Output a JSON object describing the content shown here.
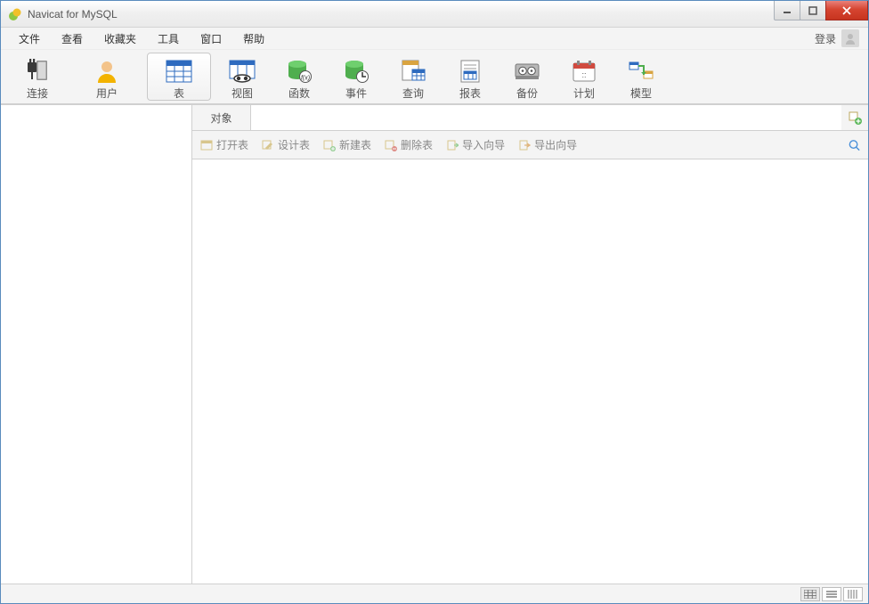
{
  "window": {
    "title": "Navicat for MySQL"
  },
  "menu": {
    "file": "文件",
    "view": "查看",
    "favorites": "收藏夹",
    "tools": "工具",
    "window": "窗口",
    "help": "帮助",
    "login": "登录"
  },
  "toolbar": {
    "connection": "连接",
    "user": "用户",
    "table": "表",
    "view": "视图",
    "function": "函数",
    "event": "事件",
    "query": "查询",
    "report": "报表",
    "backup": "备份",
    "schedule": "计划",
    "model": "模型"
  },
  "objects": {
    "tab_label": "对象"
  },
  "sub": {
    "open_table": "打开表",
    "design_table": "设计表",
    "new_table": "新建表",
    "delete_table": "删除表",
    "import_wizard": "导入向导",
    "export_wizard": "导出向导"
  }
}
